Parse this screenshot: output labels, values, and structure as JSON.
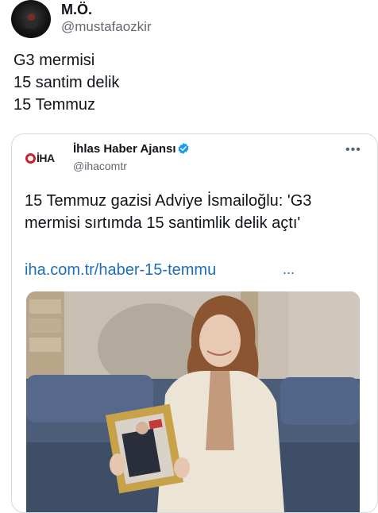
{
  "post": {
    "display_name": "M.Ö.",
    "handle": "@mustafaozkir",
    "lines": [
      "G3 mermisi",
      "15 santim delik",
      "15 Temmuz"
    ]
  },
  "quoted": {
    "logo_text": "İHA",
    "source_name": "İhlas Haber Ajansı",
    "source_handle": "@ihacomtr",
    "headline_lines": [
      "15 Temmuz gazisi Adviye İsmailoğlu: 'G3",
      "mermisi sırtımda 15 santimlik delik açtı'"
    ],
    "link_text": "iha.com.tr/haber-15-temmu",
    "link_ellipsis": "...",
    "more_label": "•••"
  },
  "colors": {
    "link": "#1d6fb8",
    "verified": "#1d9bf0",
    "logo_red": "#d21f2b",
    "handle_gray": "#606770"
  }
}
